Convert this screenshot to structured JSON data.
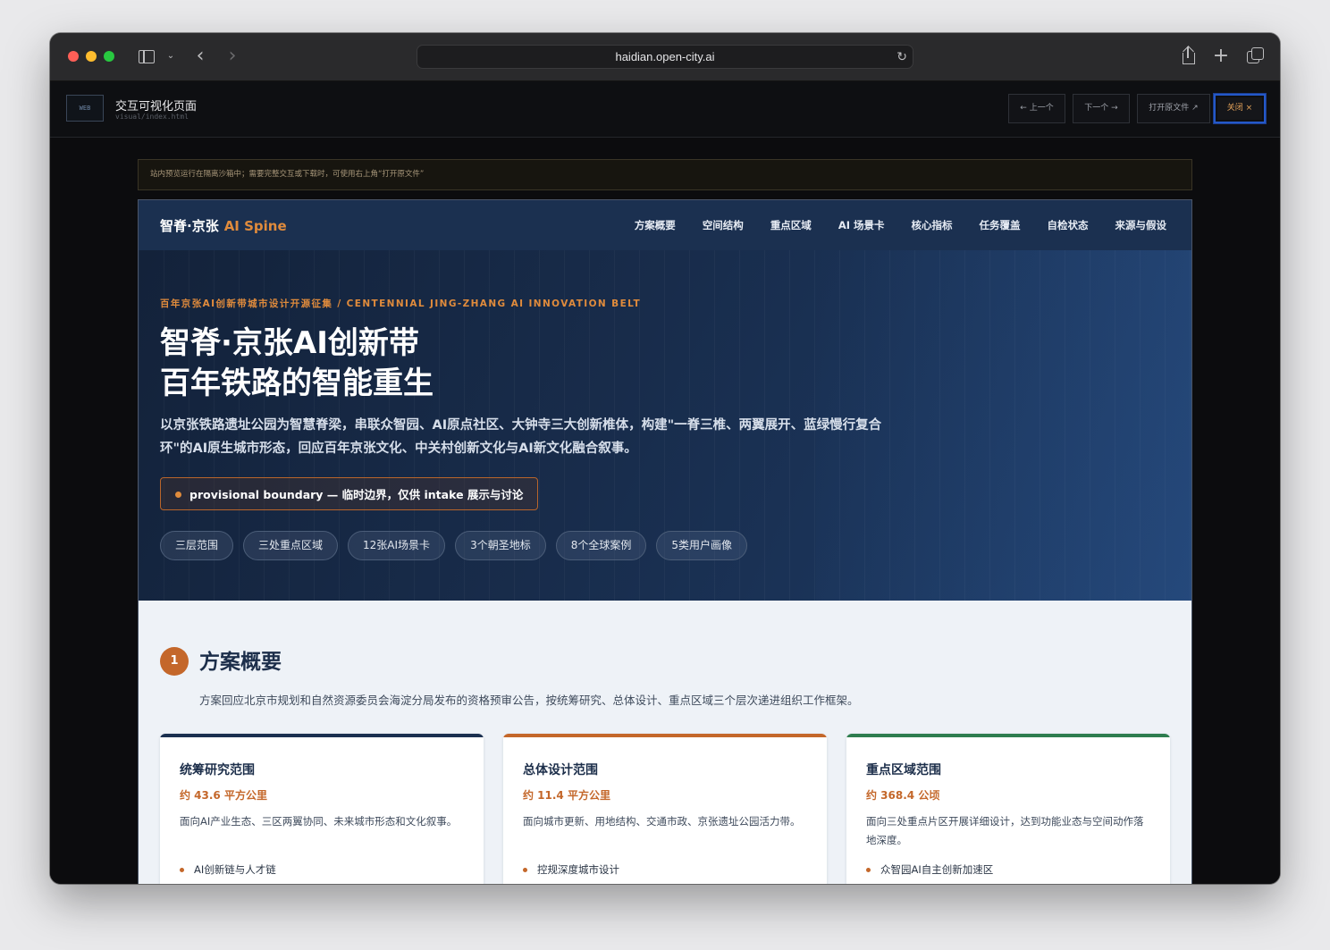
{
  "browser": {
    "url": "haidian.open-city.ai"
  },
  "viewer": {
    "badge": "WEB",
    "title": "交互可视化页面",
    "path": "visual/index.html",
    "prev_label": "← 上一个",
    "next_label": "下一个 →",
    "open_label": "打开原文件 ↗",
    "close_label": "关闭 ×",
    "notice": "站内预览运行在隔离沙箱中；需要完整交互或下载时，可使用右上角“打开原文件”"
  },
  "site": {
    "brand_main": "智脊·京张",
    "brand_accent": "AI Spine",
    "nav": [
      "方案概要",
      "空间结构",
      "重点区域",
      "AI 场景卡",
      "核心指标",
      "任务覆盖",
      "自检状态",
      "来源与假设"
    ],
    "hero": {
      "kicker": "百年京张AI创新带城市设计开源征集 / CENTENNIAL JING-ZHANG AI INNOVATION BELT",
      "title_line1": "智脊·京张AI创新带",
      "title_line2": "百年铁路的智能重生",
      "lead": "以京张铁路遗址公园为智慧脊梁，串联众智园、AI原点社区、大钟寺三大创新椎体，构建\"一脊三椎、两翼展开、蓝绿慢行复合环\"的AI原生城市形态，回应百年京张文化、中关村创新文化与AI新文化融合叙事。",
      "boundary": "provisional boundary — 临时边界，仅供 intake 展示与讨论",
      "chips": [
        "三层范围",
        "三处重点区域",
        "12张AI场景卡",
        "3个朝圣地标",
        "8个全球案例",
        "5类用户画像"
      ]
    },
    "overview": {
      "number": "1",
      "title": "方案概要",
      "desc": "方案回应北京市规划和自然资源委员会海淀分局发布的资格预审公告，按统筹研究、总体设计、重点区域三个层次递进组织工作框架。",
      "cards": [
        {
          "title": "统筹研究范围",
          "value": "约 43.6 平方公里",
          "desc": "面向AI产业生态、三区两翼协同、未来城市形态和文化叙事。",
          "item": "AI创新链与人才链",
          "color": "#1b3050"
        },
        {
          "title": "总体设计范围",
          "value": "约 11.4 平方公里",
          "desc": "面向城市更新、用地结构、交通市政、京张遗址公园活力带。",
          "item": "控规深度城市设计",
          "color": "#c4672a"
        },
        {
          "title": "重点区域范围",
          "value": "约 368.4 公顷",
          "desc": "面向三处重点片区开展详细设计，达到功能业态与空间动作落地深度。",
          "item": "众智园AI自主创新加速区",
          "color": "#2e7d4f"
        }
      ]
    }
  }
}
